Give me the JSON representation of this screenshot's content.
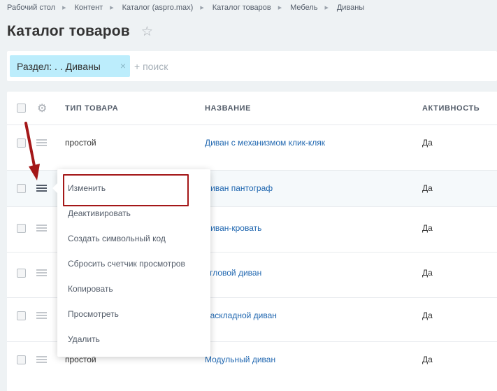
{
  "breadcrumb": {
    "items": [
      "Рабочий стол",
      "Контент",
      "Каталог (aspro.max)",
      "Каталог товаров",
      "Мебель",
      "Диваны"
    ]
  },
  "page": {
    "title": "Каталог товаров"
  },
  "filter": {
    "chip_label": "Раздел: . . Диваны",
    "search_placeholder": "+ поиск"
  },
  "grid": {
    "columns": [
      "ТИП ТОВАРА",
      "НАЗВАНИЕ",
      "АКТИВНОСТЬ"
    ],
    "rows": [
      {
        "type": "простой",
        "name": "Диван с механизмом клик-кляк",
        "active": "Да"
      },
      {
        "type": "",
        "name": "Диван пантограф",
        "active": "Да"
      },
      {
        "type": "",
        "name": "Диван-кровать",
        "active": "Да"
      },
      {
        "type": "",
        "name": "Угловой диван",
        "active": "Да"
      },
      {
        "type": "",
        "name": "Раскладной диван",
        "active": "Да"
      },
      {
        "type": "простой",
        "name": "Модульный диван",
        "active": "Да"
      }
    ]
  },
  "context_menu": {
    "items": [
      "Изменить",
      "Деактивировать",
      "Создать символьный код",
      "Сбросить счетчик просмотров",
      "Копировать",
      "Просмотреть",
      "Удалить"
    ]
  },
  "colors": {
    "link": "#2067b0",
    "chip": "#bcedfc",
    "annotation": "#a41718"
  }
}
